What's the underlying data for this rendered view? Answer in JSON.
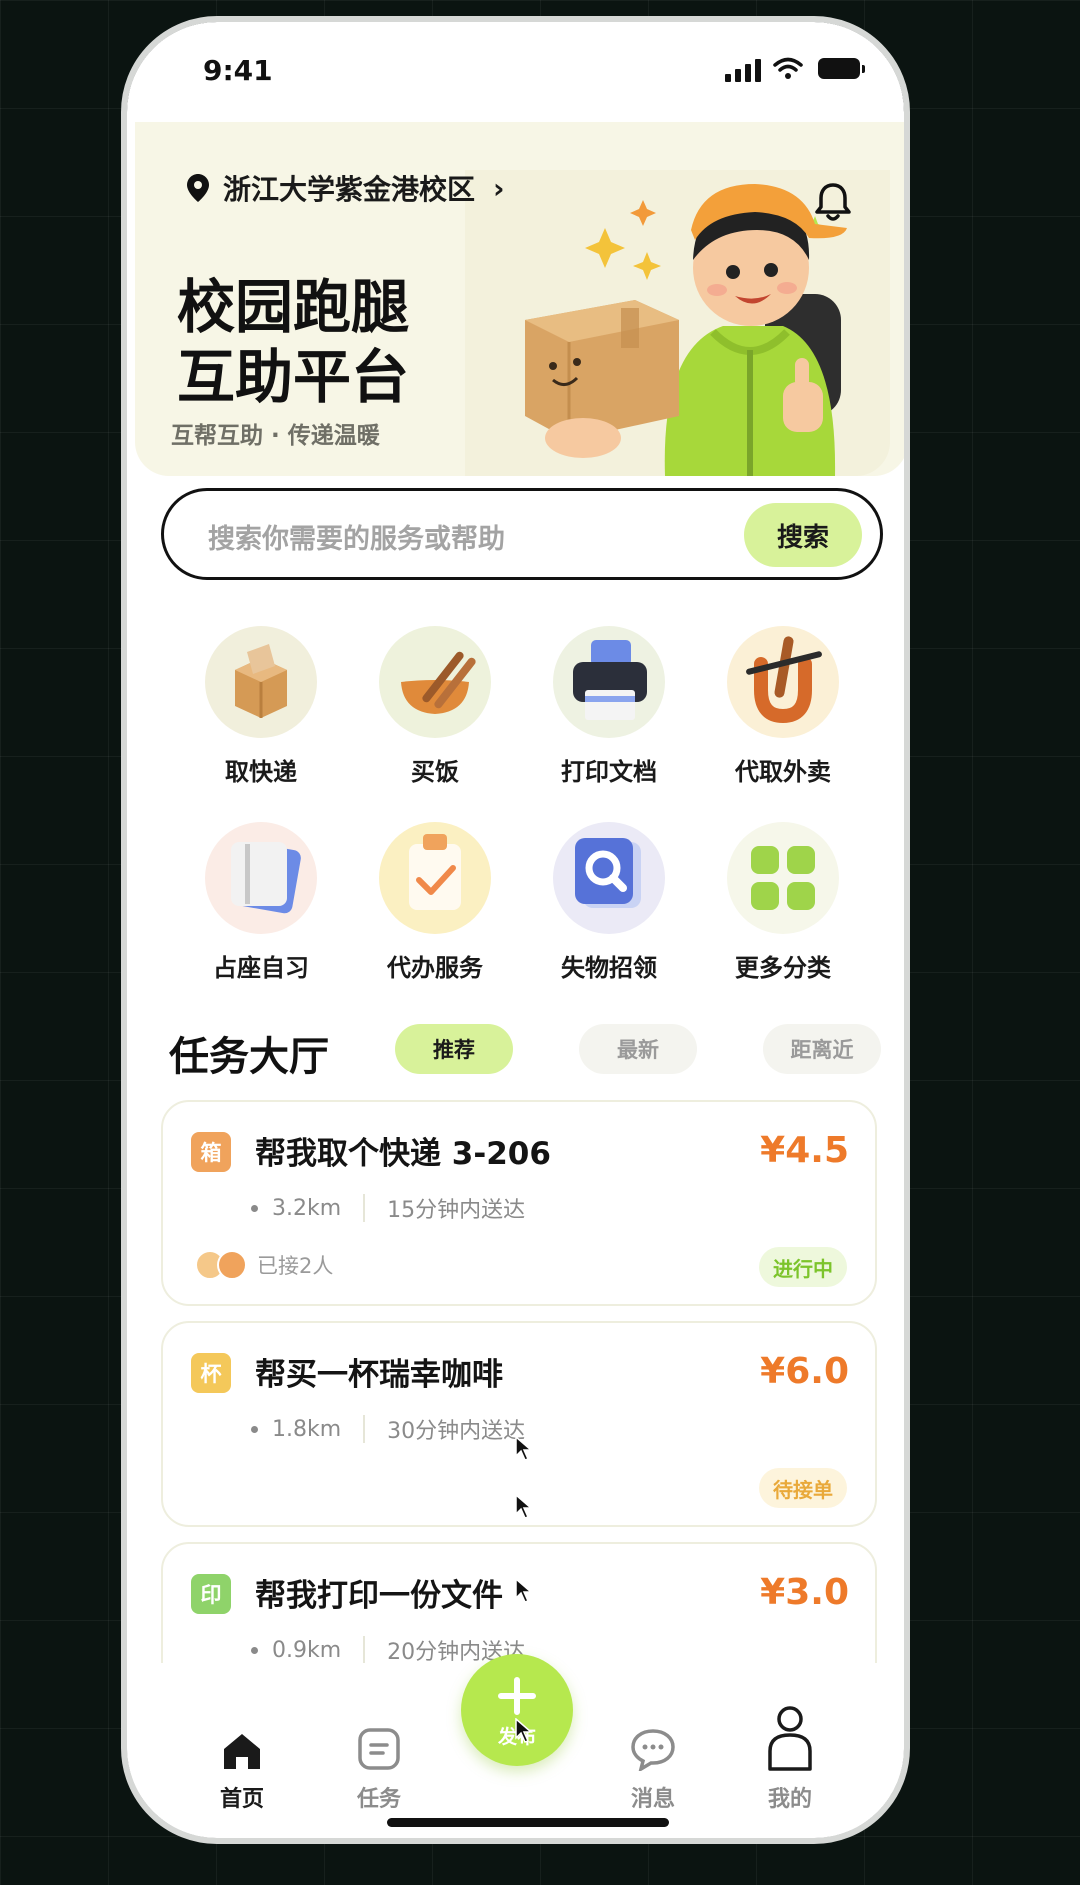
{
  "status_bar": {
    "time": "9:41"
  },
  "header": {
    "location": "浙江大学紫金港校区",
    "location_chevron": "›",
    "title_line1": "校园跑腿",
    "title_line2": "互助平台",
    "subtitle": "互帮互助 · 传递温暖"
  },
  "search": {
    "placeholder": "搜索你需要的服务或帮助",
    "button": "搜索"
  },
  "categories": [
    {
      "label": "取快递",
      "icon": "package-icon"
    },
    {
      "label": "买饭",
      "icon": "food-bowl-icon"
    },
    {
      "label": "打印文档",
      "icon": "printer-icon"
    },
    {
      "label": "代取外卖",
      "icon": "takeout-icon"
    },
    {
      "label": "占座自习",
      "icon": "book-icon"
    },
    {
      "label": "代办服务",
      "icon": "clipboard-check-icon"
    },
    {
      "label": "失物招领",
      "icon": "magnifier-icon"
    },
    {
      "label": "更多分类",
      "icon": "grid-icon"
    }
  ],
  "hall": {
    "title": "任务大厅",
    "tabs": [
      {
        "label": "推荐",
        "active": true
      },
      {
        "label": "最新",
        "active": false
      },
      {
        "label": "距离近",
        "active": false
      }
    ]
  },
  "tasks": [
    {
      "tag": "箱",
      "tag_color": "#f0a35c",
      "title": "帮我取个快递 3-206",
      "price": "¥4.5",
      "distance": "3.2km",
      "eta": "15分钟内送达",
      "takers": "已接2人",
      "status": "进行中",
      "status_color": "#7cc42b",
      "status_bg": "#eef8dc"
    },
    {
      "tag": "杯",
      "tag_color": "#f4c85a",
      "title": "帮买一杯瑞幸咖啡",
      "price": "¥6.0",
      "distance": "1.8km",
      "eta": "30分钟内送达",
      "takers": "",
      "status": "待接单",
      "status_color": "#e9a93a",
      "status_bg": "#fdf4dc"
    },
    {
      "tag": "印",
      "tag_color": "#8fd36a",
      "title": "帮我打印一份文件",
      "price": "¥3.0",
      "distance": "0.9km",
      "eta": "20分钟内送达",
      "takers": "",
      "status": "",
      "status_color": "",
      "status_bg": ""
    }
  ],
  "tabbar": {
    "home": "首页",
    "tasks": "任务",
    "publish": "发布",
    "messages": "消息",
    "mine": "我的"
  },
  "colors": {
    "accent": "#b6e84e",
    "price": "#ee7a2a",
    "hero_bg": "#f7f6e6"
  }
}
